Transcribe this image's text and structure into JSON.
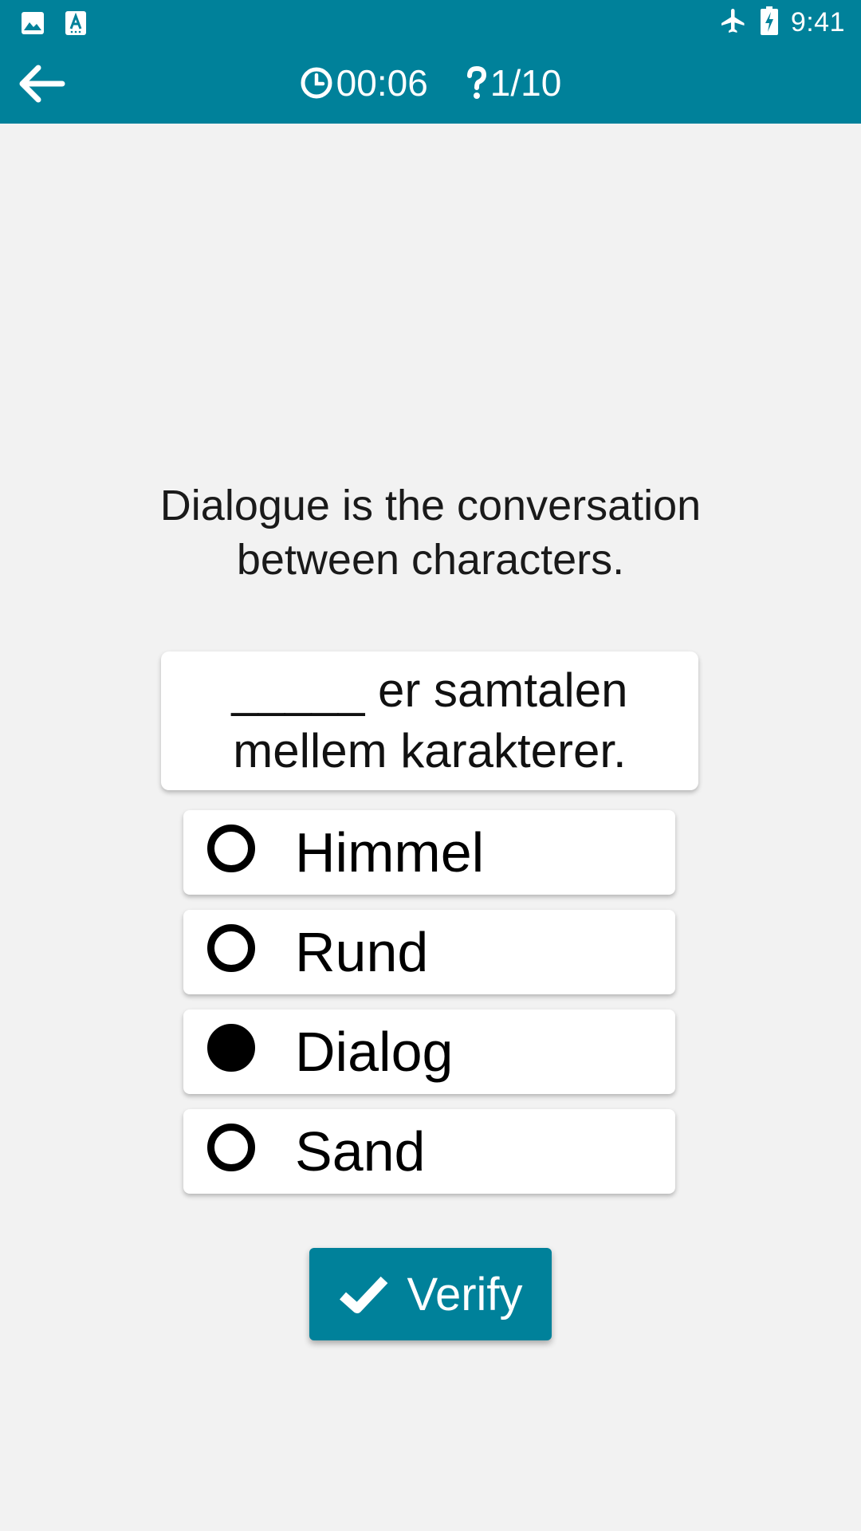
{
  "status_bar": {
    "time": "9:41",
    "left_icons": [
      "image-icon",
      "font-download-icon"
    ],
    "right_icons": [
      "airplane-mode-icon",
      "battery-charging-icon"
    ]
  },
  "toolbar": {
    "back_icon": "arrow-left-icon",
    "timer_icon": "clock-icon",
    "timer": "00:06",
    "progress_icon": "question-icon",
    "progress": "1/10"
  },
  "quiz": {
    "prompt": "Dialogue is the conversation between characters.",
    "sentence": "_____ er samtalen mellem karakterer.",
    "options": [
      {
        "label": "Himmel",
        "selected": false
      },
      {
        "label": "Rund",
        "selected": false
      },
      {
        "label": "Dialog",
        "selected": true
      },
      {
        "label": "Sand",
        "selected": false
      }
    ],
    "verify_label": "Verify",
    "verify_icon": "check-icon"
  },
  "colors": {
    "accent": "#00819a",
    "background": "#f2f2f2",
    "card": "#ffffff"
  }
}
